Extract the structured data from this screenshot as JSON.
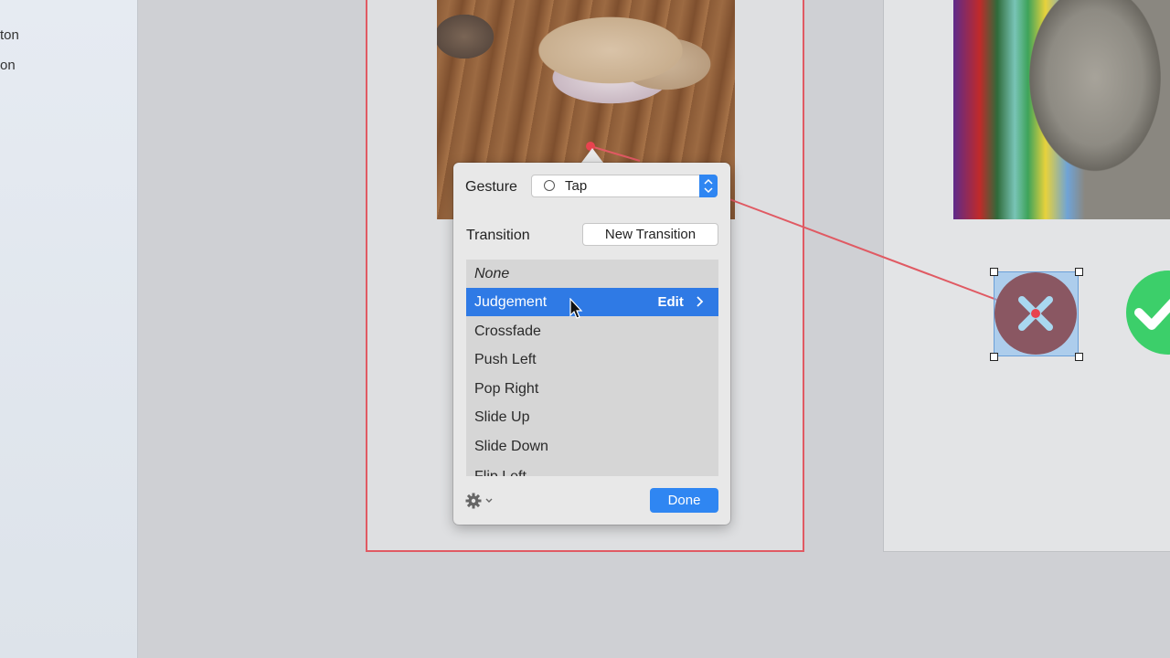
{
  "sidebar": {
    "items": [
      {
        "label": "ton"
      },
      {
        "label": "on"
      }
    ]
  },
  "popover": {
    "gesture_label": "Gesture",
    "gesture_value": "Tap",
    "transition_label": "Transition",
    "new_transition_label": "New Transition",
    "transitions": [
      {
        "label": "None"
      },
      {
        "label": "Judgement",
        "edit_label": "Edit"
      },
      {
        "label": "Crossfade"
      },
      {
        "label": "Push Left"
      },
      {
        "label": "Pop Right"
      },
      {
        "label": "Slide Up"
      },
      {
        "label": "Slide Down"
      },
      {
        "label": "Flip Left"
      }
    ],
    "selected_transition": "Judgement",
    "done_label": "Done"
  },
  "colors": {
    "accent": "#2f86f2",
    "selection": "#2f7ae5",
    "connection": "#e05a63",
    "accept": "#3ccf6a",
    "reject": "#8a5762"
  }
}
